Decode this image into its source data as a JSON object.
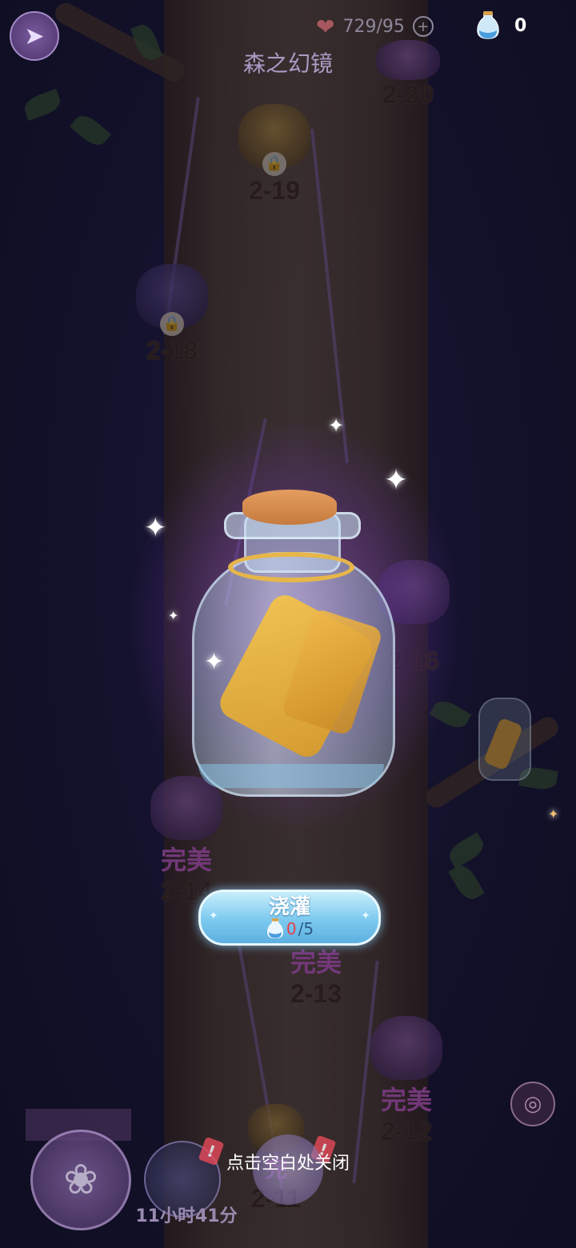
{
  "header": {
    "back_icon": "back-arrow-icon",
    "hearts_value": "729/95",
    "heart_icon": "heart-icon",
    "add_icon": "plus-circle-icon",
    "water_icon": "water-jug-icon",
    "water_value": "0",
    "title": "森之幻镜"
  },
  "levels": [
    {
      "id": "2-20",
      "perfect": ""
    },
    {
      "id": "2-19",
      "perfect": ""
    },
    {
      "id": "2-18",
      "perfect": ""
    },
    {
      "id": "2-16",
      "perfect": ""
    },
    {
      "id": "2-14",
      "perfect": "完美"
    },
    {
      "id": "2-13",
      "perfect": "完美"
    },
    {
      "id": "2-12",
      "perfect": "完美"
    },
    {
      "id": "2-11",
      "perfect": "完"
    }
  ],
  "popup": {
    "item": "message-bottle-scroll",
    "water_button": {
      "label": "浇灌",
      "current": "0",
      "total": "/5"
    }
  },
  "bottom": {
    "close_hint": "点击空白处关闭",
    "timer": "11小时41分",
    "badge": "!",
    "target_icon": "locate-target-icon",
    "skill_icon": "shell-icon"
  },
  "colors": {
    "perfect_text": "#c85fc8",
    "button_blue": "#7cc9ef",
    "progress_current": "#e8404a"
  }
}
